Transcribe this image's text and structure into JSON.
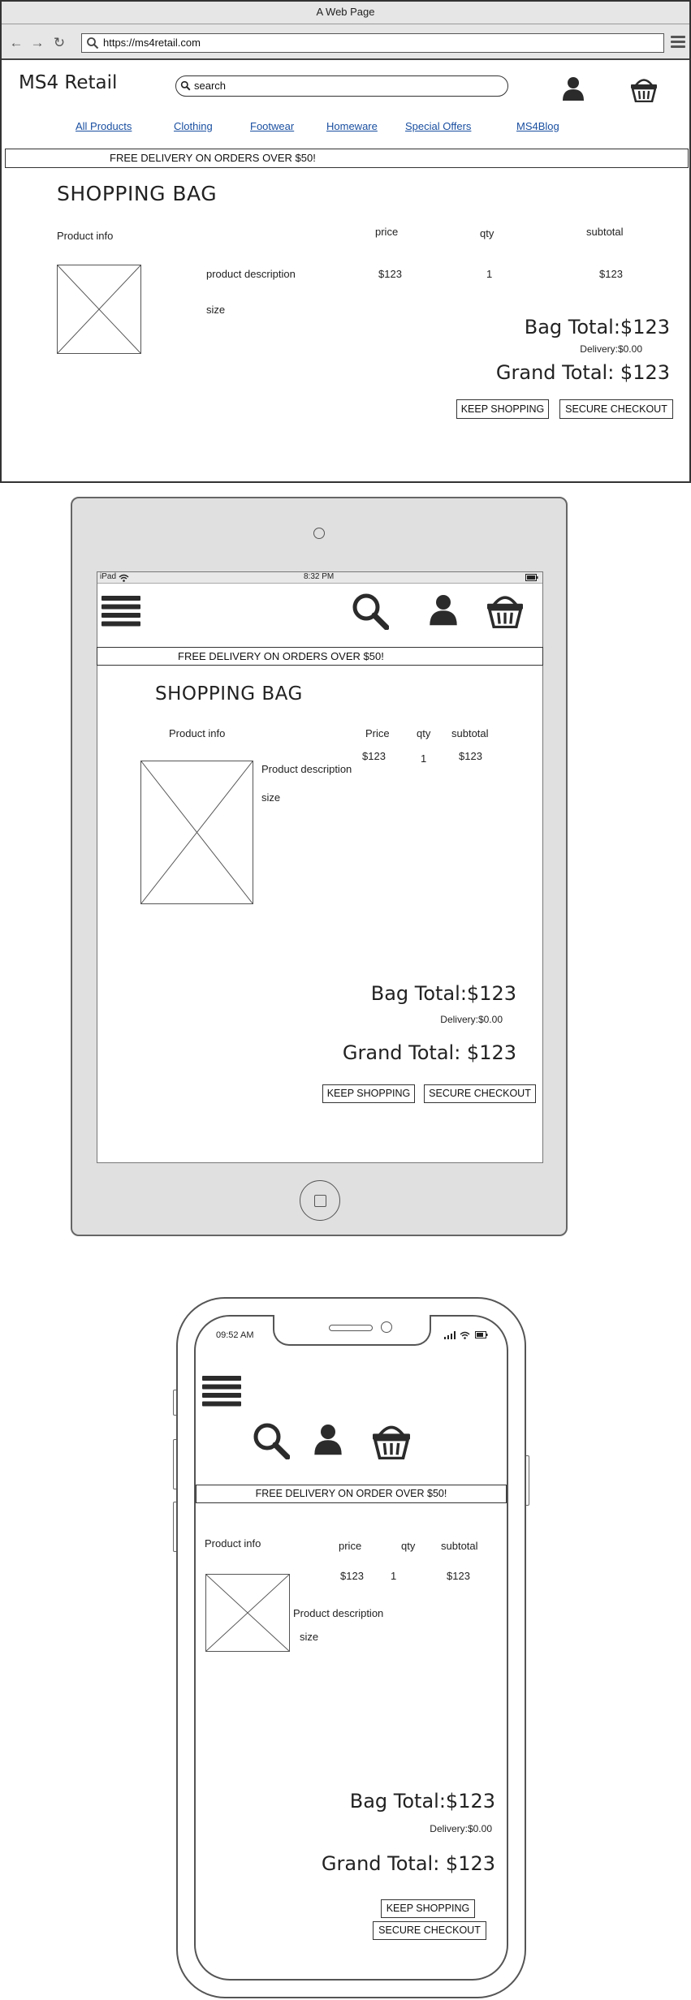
{
  "desktop": {
    "window_title": "A Web Page",
    "url": "https://ms4retail.com",
    "brand": "MS4 Retail",
    "search_placeholder": "search",
    "nav": [
      "All Products",
      "Clothing",
      "Footwear",
      "Homeware",
      "Special Offers",
      "MS4Blog"
    ],
    "banner": "FREE DELIVERY ON ORDERS OVER $50!",
    "title": "SHOPPING BAG",
    "headers": {
      "product": "Product info",
      "price": "price",
      "qty": "qty",
      "subtotal": "subtotal"
    },
    "item": {
      "description": "product description",
      "size": "size",
      "price": "$123",
      "qty": "1",
      "subtotal": "$123"
    },
    "bag_total": "Bag Total:$123",
    "delivery": "Delivery:$0.00",
    "grand_total": "Grand Total: $123",
    "keep_shopping": "KEEP SHOPPING",
    "checkout": "SECURE CHECKOUT"
  },
  "tablet": {
    "status_device": "iPad",
    "status_time": "8:32 PM",
    "banner": "FREE DELIVERY ON ORDERS OVER $50!",
    "title": "SHOPPING BAG",
    "headers": {
      "product": "Product info",
      "price": "Price",
      "qty": "qty",
      "subtotal": "subtotal"
    },
    "item": {
      "description": "Product description",
      "size": "size",
      "price": "$123",
      "qty": "1",
      "subtotal": "$123"
    },
    "bag_total": "Bag Total:$123",
    "delivery": "Delivery:$0.00",
    "grand_total": "Grand Total: $123",
    "keep_shopping": "KEEP SHOPPING",
    "checkout": "SECURE CHECKOUT"
  },
  "phone": {
    "status_time": "09:52 AM",
    "banner": "FREE DELIVERY ON ORDER  OVER $50!",
    "headers": {
      "product": "Product info",
      "price": "price",
      "qty": "qty",
      "subtotal": "subtotal"
    },
    "item": {
      "description": "Product description",
      "size": "size",
      "price": "$123",
      "qty": "1",
      "subtotal": "$123"
    },
    "bag_total": "Bag Total:$123",
    "delivery": "Delivery:$0.00",
    "grand_total": "Grand Total: $123",
    "keep_shopping": "KEEP SHOPPING",
    "checkout": "SECURE CHECKOUT"
  },
  "icons": {
    "back": "arrow-left-icon",
    "forward": "arrow-right-icon",
    "reload": "reload-icon",
    "search": "search-icon",
    "menu": "hamburger-menu-icon",
    "user": "user-icon",
    "basket": "basket-icon",
    "image_placeholder": "image-placeholder-icon",
    "wifi": "wifi-icon",
    "battery": "battery-icon",
    "signal": "signal-icon"
  },
  "colors": {
    "link": "#1a4fa0",
    "chrome": "#e6e6e6",
    "ink": "#222222",
    "device": "#e0e0e0"
  }
}
